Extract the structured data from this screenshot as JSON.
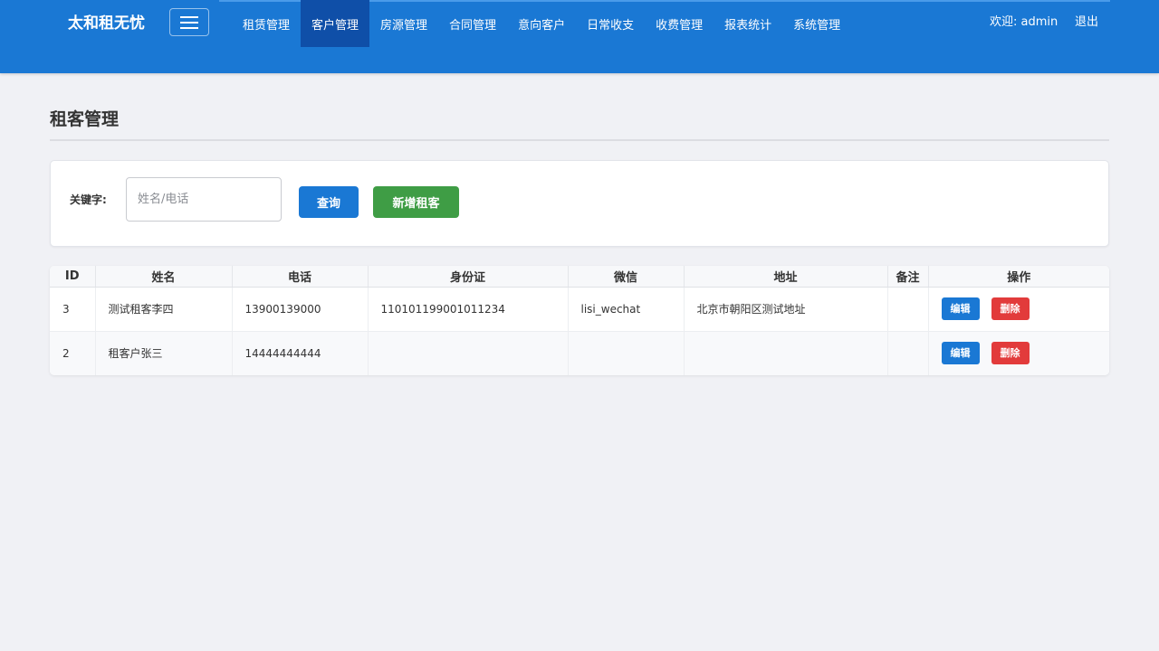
{
  "header": {
    "brand": "太和租无忧",
    "nav": [
      {
        "label": "租赁管理",
        "active": false
      },
      {
        "label": "客户管理",
        "active": true
      },
      {
        "label": "房源管理",
        "active": false
      },
      {
        "label": "合同管理",
        "active": false
      },
      {
        "label": "意向客户",
        "active": false
      },
      {
        "label": "日常收支",
        "active": false
      },
      {
        "label": "收费管理",
        "active": false
      },
      {
        "label": "报表统计",
        "active": false
      },
      {
        "label": "系统管理",
        "active": false
      }
    ],
    "welcome": "欢迎: admin",
    "logout": "退出"
  },
  "page": {
    "title": "租客管理"
  },
  "search": {
    "label": "关键字:",
    "value": "",
    "placeholder": "姓名/电话",
    "query_button": "查询",
    "add_button": "新增租客"
  },
  "table": {
    "columns": [
      "ID",
      "姓名",
      "电话",
      "身份证",
      "微信",
      "地址",
      "备注",
      "操作"
    ],
    "rows": [
      {
        "id": "3",
        "name": "测试租客李四",
        "phone": "13900139000",
        "id_card": "110101199001011234",
        "wechat": "lisi_wechat",
        "address": "北京市朝阳区测试地址",
        "note": ""
      },
      {
        "id": "2",
        "name": "租客户张三",
        "phone": "14444444444",
        "id_card": "",
        "wechat": "",
        "address": "",
        "note": ""
      }
    ],
    "edit_label": "编辑",
    "delete_label": "删除"
  },
  "colors": {
    "primary": "#1a78d4",
    "nav_active": "#0f4fa8",
    "success": "#3f9d45",
    "danger": "#e23b3b",
    "background": "#f0f1f5"
  }
}
